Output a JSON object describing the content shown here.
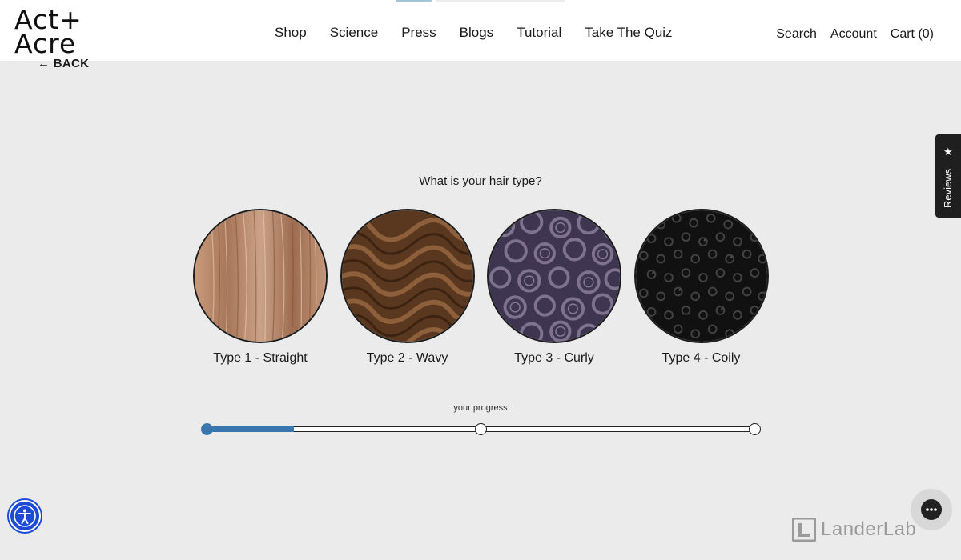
{
  "logo": {
    "line1": "Act+",
    "line2": "Acre"
  },
  "nav": [
    "Shop",
    "Science",
    "Press",
    "Blogs",
    "Tutorial",
    "Take The Quiz"
  ],
  "utility": {
    "search": "Search",
    "account": "Account",
    "cart": "Cart (0)"
  },
  "back_label": "← BACK",
  "question": "What is your hair type?",
  "options": [
    {
      "label": "Type 1 - Straight",
      "image": "straight-hair-photo",
      "color": "#b98b6d"
    },
    {
      "label": "Type 2 - Wavy",
      "image": "wavy-hair-photo",
      "color": "#6b4326"
    },
    {
      "label": "Type 3 - Curly",
      "image": "curly-hair-photo",
      "color": "#5d5470"
    },
    {
      "label": "Type 4 - Coily",
      "image": "coily-hair-photo",
      "color": "#1b1b1b"
    }
  ],
  "progress": {
    "label": "your progress",
    "value": 0.16,
    "steps": 3,
    "current_step": 1
  },
  "reviews_tab": {
    "label": "Reviews",
    "icon": "star-icon"
  },
  "watermark": "LanderLab",
  "colors": {
    "accent": "#3a76ae",
    "background": "#ebebeb",
    "a11y": "#1d4bd6"
  }
}
